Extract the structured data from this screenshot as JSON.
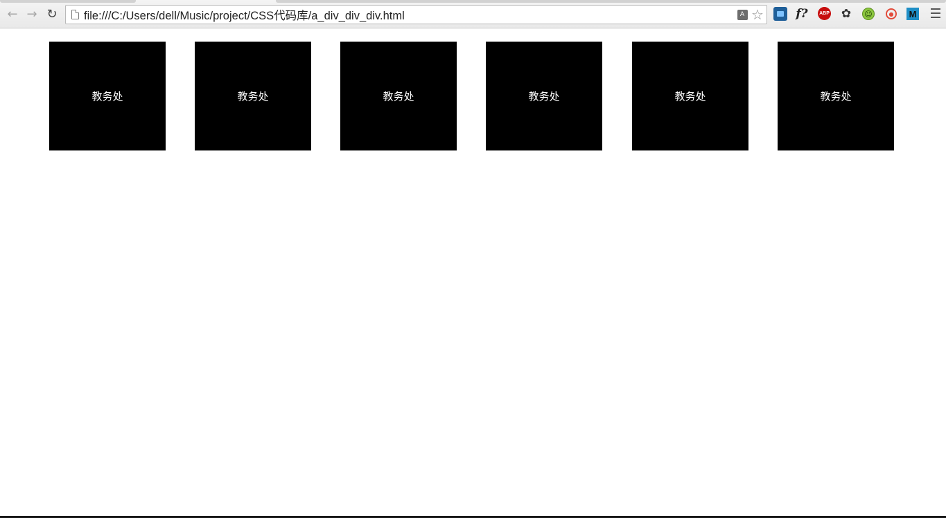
{
  "browser": {
    "url": "file:///C:/Users/dell/Music/project/CSS代码库/a_div_div_div.html",
    "back_icon": "back-arrow-icon",
    "forward_icon": "forward-arrow-icon",
    "reload_icon": "reload-icon",
    "extensions": [
      "translate-icon",
      "bookmark-star-icon",
      "blue-extension-icon",
      "font-finder-icon",
      "adblock-plus-icon",
      "leaf-extension-icon",
      "green-face-extension-icon",
      "timer-extension-icon",
      "m-extension-icon",
      "menu-icon"
    ],
    "abp_label": "ABP",
    "f_label": "f?",
    "m_label": "M"
  },
  "page": {
    "boxes": [
      {
        "label": "教务处"
      },
      {
        "label": "教务处"
      },
      {
        "label": "教务处"
      },
      {
        "label": "教务处"
      },
      {
        "label": "教务处"
      },
      {
        "label": "教务处"
      }
    ]
  },
  "colors": {
    "box_background": "#000000",
    "box_text": "#ffffff",
    "page_background": "#ffffff"
  }
}
